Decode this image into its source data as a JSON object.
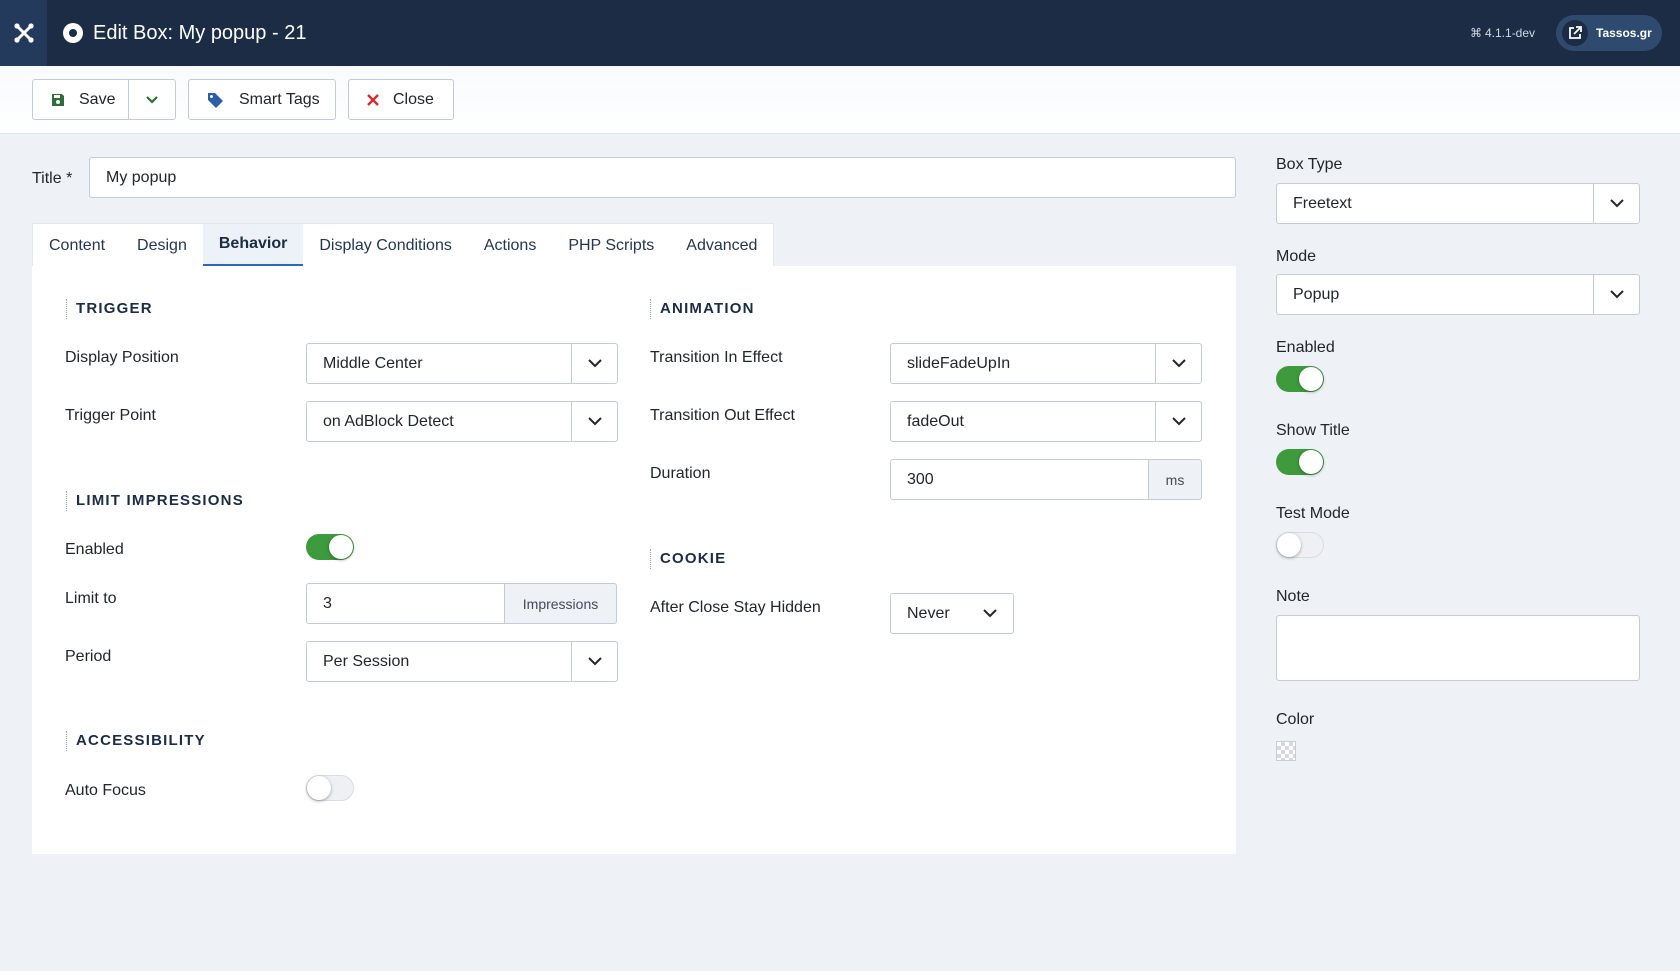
{
  "header": {
    "title": "Edit Box: My popup - 21",
    "version": "4.1.1-dev",
    "user_label": "Tassos.gr"
  },
  "toolbar": {
    "save_label": "Save",
    "smart_tags_label": "Smart Tags",
    "close_label": "Close"
  },
  "title_field": {
    "label": "Title *",
    "value": "My popup"
  },
  "tabs": [
    {
      "label": "Content"
    },
    {
      "label": "Design"
    },
    {
      "label": "Behavior",
      "active": true
    },
    {
      "label": "Display Conditions"
    },
    {
      "label": "Actions"
    },
    {
      "label": "PHP Scripts"
    },
    {
      "label": "Advanced"
    }
  ],
  "behavior": {
    "trigger": {
      "heading": "TRIGGER",
      "display_position_label": "Display Position",
      "display_position_value": "Middle Center",
      "trigger_point_label": "Trigger Point",
      "trigger_point_value": "on AdBlock Detect"
    },
    "limit_impressions": {
      "heading": "LIMIT IMPRESSIONS",
      "enabled_label": "Enabled",
      "enabled": true,
      "limit_to_label": "Limit to",
      "limit_to_value": "3",
      "limit_to_unit": "Impressions",
      "period_label": "Period",
      "period_value": "Per Session"
    },
    "accessibility": {
      "heading": "ACCESSIBILITY",
      "auto_focus_label": "Auto Focus",
      "auto_focus": false
    },
    "animation": {
      "heading": "ANIMATION",
      "transition_in_label": "Transition In Effect",
      "transition_in_value": "slideFadeUpIn",
      "transition_out_label": "Transition Out Effect",
      "transition_out_value": "fadeOut",
      "duration_label": "Duration",
      "duration_value": "300",
      "duration_unit": "ms"
    },
    "cookie": {
      "heading": "COOKIE",
      "after_close_label": "After Close Stay Hidden",
      "after_close_value": "Never"
    }
  },
  "sidebar": {
    "box_type_label": "Box Type",
    "box_type_value": "Freetext",
    "mode_label": "Mode",
    "mode_value": "Popup",
    "enabled_label": "Enabled",
    "enabled": true,
    "show_title_label": "Show Title",
    "show_title": true,
    "test_mode_label": "Test Mode",
    "test_mode": false,
    "note_label": "Note",
    "note_value": "",
    "color_label": "Color"
  },
  "colors": {
    "header_bg": "#1b2c44",
    "toggle_on": "#3d9a3d",
    "tab_active_border": "#2a69b8",
    "close_icon": "#d42d2d",
    "save_icon": "#2f6e3b",
    "tag_icon": "#2a5fa8"
  }
}
